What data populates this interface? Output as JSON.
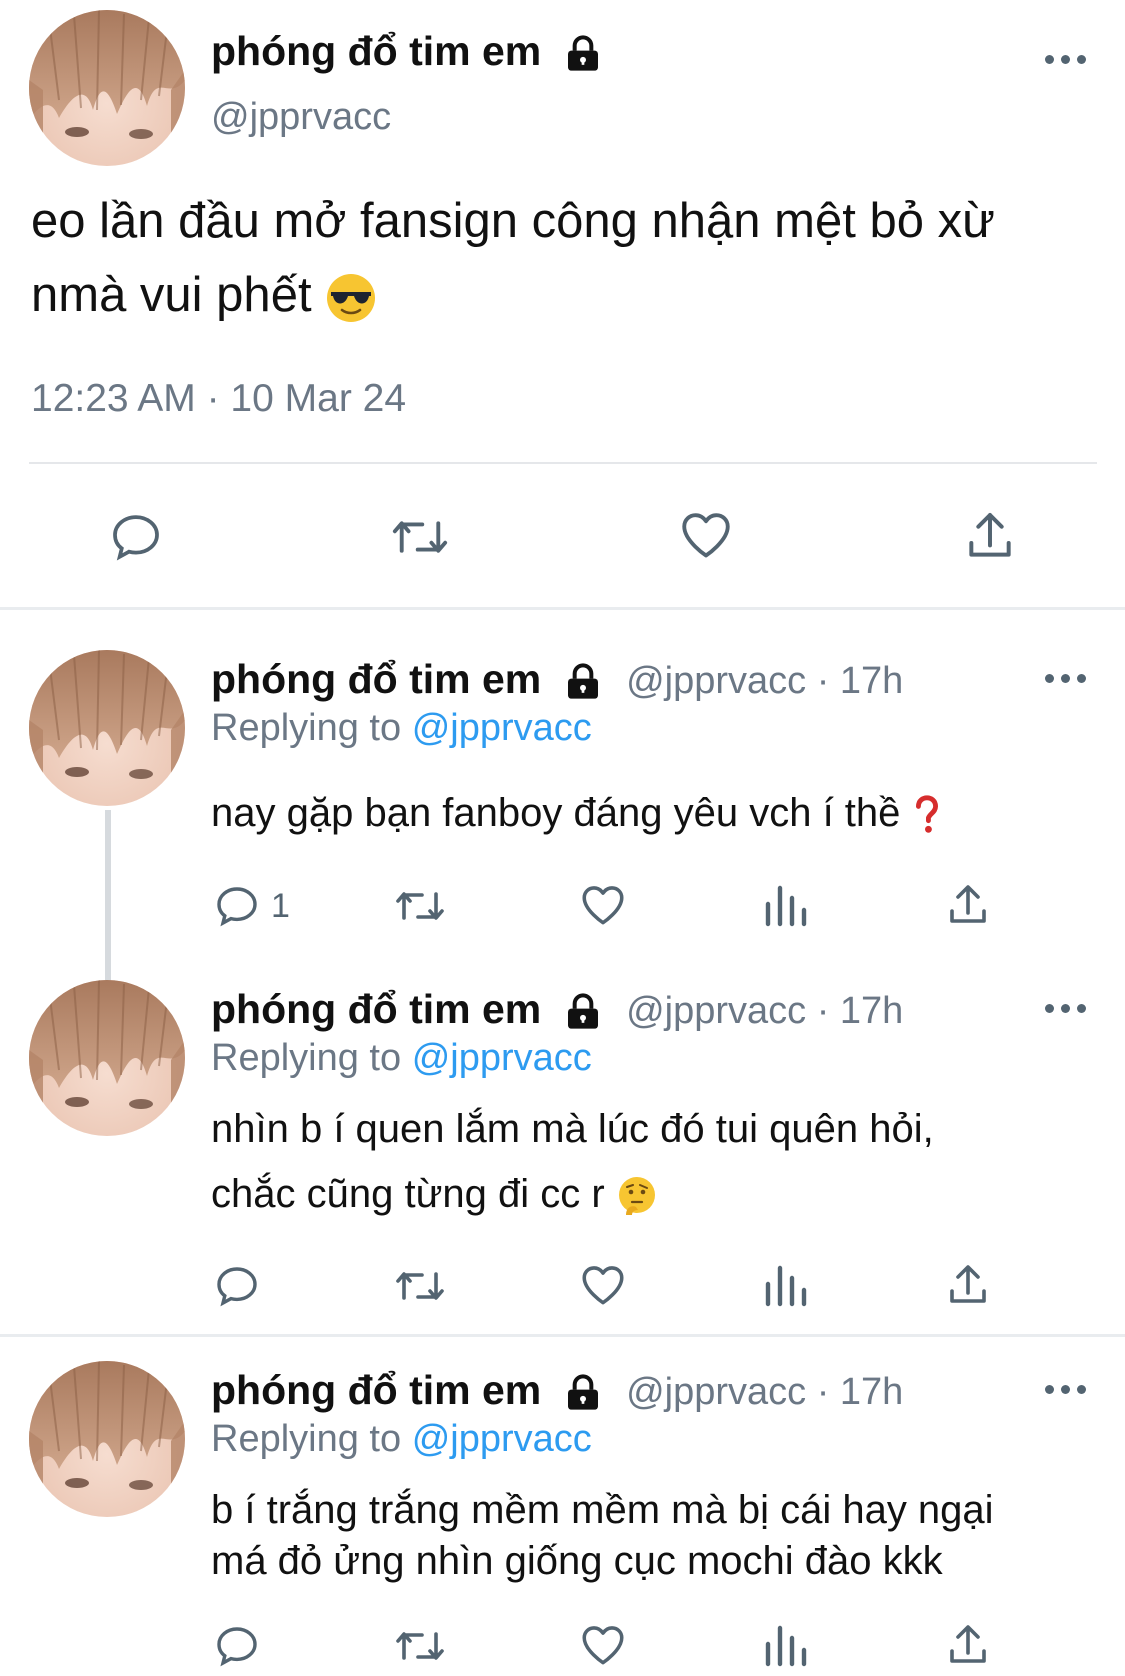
{
  "main_tweet": {
    "name": "phóng đổ tim em",
    "handle": "@jpprvacc",
    "text": "eo lần đầu mở fansign công nhận mệt bỏ xừ nmà vui phết",
    "emoji": "sunglasses-emoji",
    "timestamp": "12:23 AM · 10 Mar 24"
  },
  "replies": [
    {
      "name": "phóng đổ tim em",
      "handle_time": "@jpprvacc · 17h",
      "replying_prefix": "Replying to",
      "replying_handle": "@jpprvacc",
      "text": "nay gặp bạn fanboy đáng yêu vch í thề",
      "emoji": "question-mark-emoji",
      "reply_count": "1"
    },
    {
      "name": "phóng đổ tim em",
      "handle_time": "@jpprvacc · 17h",
      "replying_prefix": "Replying to",
      "replying_handle": "@jpprvacc",
      "text_line1": "nhìn b í quen lắm mà lúc đó tui quên hỏi,",
      "text_line2": "chắc cũng từng đi cc r",
      "emoji": "thinking-emoji"
    },
    {
      "name": "phóng đổ tim em",
      "handle_time": "@jpprvacc · 17h",
      "replying_prefix": "Replying to",
      "replying_handle": "@jpprvacc",
      "text_line1": "b í trắng trắng mềm mềm mà bị cái hay ngại",
      "text_line2": "má đỏ ửng nhìn giống cục mochi đào kkk"
    }
  ],
  "colors": {
    "link": "#2d9bf0",
    "muted": "#6b7785",
    "icon": "#536471",
    "divider": "#e9ecef"
  }
}
